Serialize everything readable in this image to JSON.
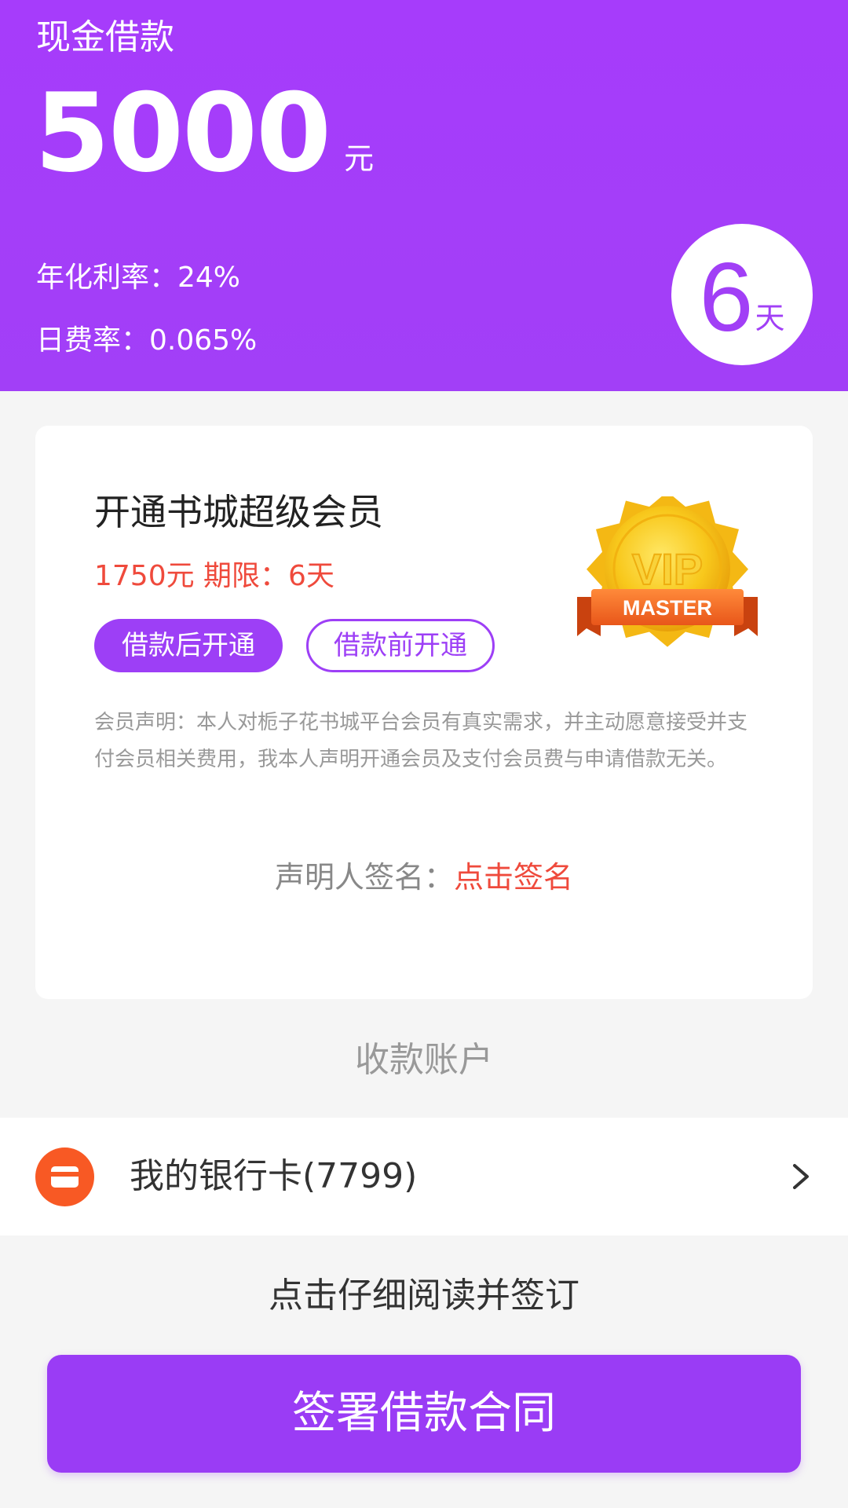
{
  "header": {
    "title": "现金借款",
    "amount": "5000",
    "amount_unit": "元",
    "annual_rate": "年化利率：24%",
    "daily_rate": "日费率：0.065%",
    "days_num": "6",
    "days_unit": "天"
  },
  "membership": {
    "title": "开通书城超级会员",
    "price_term": "1750元  期限：6天",
    "btn_after": "借款后开通",
    "btn_before": "借款前开通",
    "badge_vip": "VIP",
    "badge_master": "MASTER",
    "declaration": "会员声明：本人对栀子花书城平台会员有真实需求，并主动愿意接受并支付会员相关费用，我本人声明开通会员及支付会员费与申请借款无关。",
    "sign_label": "声明人签名：",
    "sign_link": "点击签名"
  },
  "account": {
    "section_label": "收款账户",
    "bank_card": "我的银行卡(7799)"
  },
  "footer": {
    "read_hint": "点击仔细阅读并签订",
    "sign_button": "签署借款合同"
  },
  "colors": {
    "primary": "#a23ff7",
    "accent_red": "#ef4a3c",
    "bank_orange": "#f85924"
  }
}
